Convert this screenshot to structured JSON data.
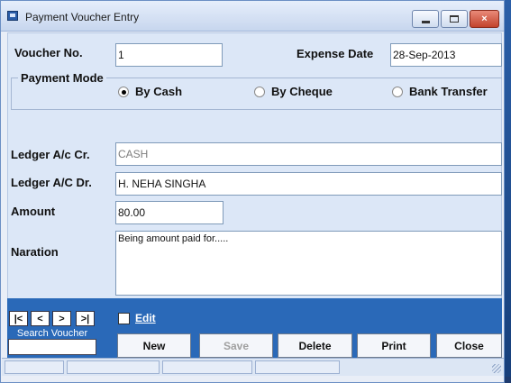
{
  "window": {
    "title": "Payment Voucher Entry",
    "close_glyph": "×"
  },
  "voucher": {
    "label": "Voucher No.",
    "value": "1"
  },
  "expense_date": {
    "label": "Expense Date",
    "value": "28-Sep-2013"
  },
  "payment_mode": {
    "legend": "Payment Mode",
    "options": [
      {
        "label": "By Cash",
        "selected": true
      },
      {
        "label": "By Cheque",
        "selected": false
      },
      {
        "label": "Bank Transfer",
        "selected": false
      }
    ]
  },
  "ledger_cr": {
    "label": "Ledger A/c Cr.",
    "value": "CASH"
  },
  "ledger_dr": {
    "label": "Ledger A/C Dr.",
    "value": "H. NEHA SINGHA"
  },
  "amount": {
    "label": "Amount",
    "value": "80.00"
  },
  "naration": {
    "label": "Naration",
    "value": "Being amount paid for....."
  },
  "navigation": {
    "first": "|<",
    "prev": "<",
    "next": ">",
    "last": ">|",
    "search_label": "Search Voucher",
    "search_value": ""
  },
  "edit": {
    "label": "Edit",
    "checked": false
  },
  "actions": {
    "new": "New",
    "save": "Save",
    "delete": "Delete",
    "print": "Print",
    "close": "Close"
  }
}
